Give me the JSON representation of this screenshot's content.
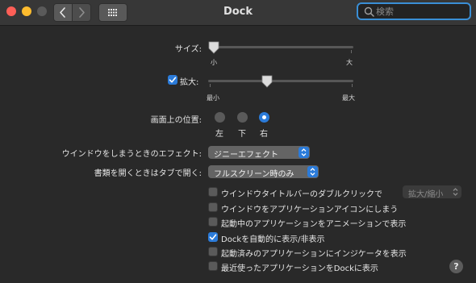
{
  "window": {
    "title": "Dock"
  },
  "search": {
    "placeholder": "検索",
    "value": ""
  },
  "icons": {
    "back": "chevron-left-icon",
    "forward": "chevron-right-icon",
    "grid": "grid-icon",
    "search": "search-icon",
    "help": "help-icon"
  },
  "colors": {
    "accent": "#2b7bd9",
    "close": "#fe5f57",
    "minimize": "#febc2e",
    "search_focus": "#3a8fd6"
  },
  "size": {
    "label": "サイズ:",
    "min_label": "小",
    "max_label": "大",
    "value": 0.0
  },
  "magnification": {
    "label": "拡大:",
    "checked": true,
    "min_label": "最小",
    "max_label": "最大",
    "value": 0.4
  },
  "position": {
    "label": "画面上の位置:",
    "options": [
      "左",
      "下",
      "右"
    ],
    "selected": 2
  },
  "minimize_effect": {
    "label": "ウインドウをしまうときのエフェクト:",
    "value": "ジニーエフェクト"
  },
  "prefer_tabs": {
    "label": "書類を開くときはタブで開く:",
    "value": "フルスクリーン時のみ"
  },
  "double_click": {
    "label": "ウインドウタイトルバーのダブルクリックで",
    "checked": false,
    "popup_value": "拡大/縮小"
  },
  "checkboxes": [
    {
      "label": "ウインドウをアプリケーションアイコンにしまう",
      "checked": false
    },
    {
      "label": "起動中のアプリケーションをアニメーションで表示",
      "checked": false
    },
    {
      "label": "Dockを自動的に表示/非表示",
      "checked": true
    },
    {
      "label": "起動済みのアプリケーションにインジケータを表示",
      "checked": false
    },
    {
      "label": "最近使ったアプリケーションをDockに表示",
      "checked": false
    }
  ],
  "help": {
    "label": "?"
  }
}
